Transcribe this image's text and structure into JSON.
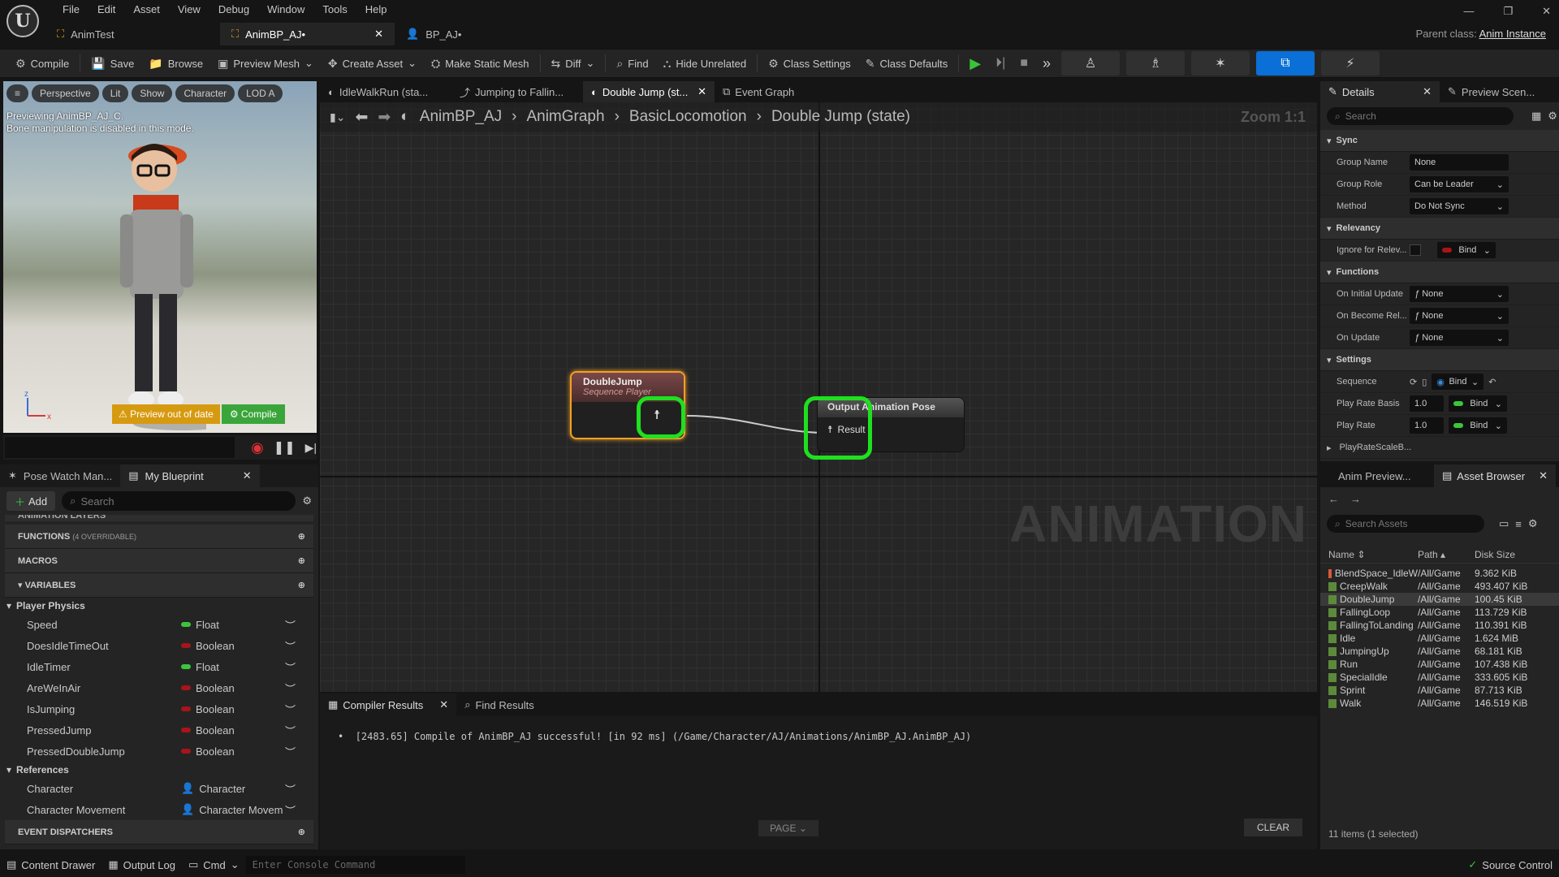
{
  "menu": [
    "File",
    "Edit",
    "Asset",
    "View",
    "Debug",
    "Window",
    "Tools",
    "Help"
  ],
  "doc_tabs": [
    {
      "label": "AnimTest",
      "active": false
    },
    {
      "label": "AnimBP_AJ•",
      "active": true
    },
    {
      "label": "BP_AJ•",
      "active": false
    }
  ],
  "parent_class": {
    "label": "Parent class:",
    "value": "Anim Instance"
  },
  "toolbar": {
    "compile": "Compile",
    "save": "Save",
    "browse": "Browse",
    "preview_mesh": "Preview Mesh",
    "create_asset": "Create Asset",
    "make_static_mesh": "Make Static Mesh",
    "diff": "Diff",
    "find": "Find",
    "hide_unrelated": "Hide Unrelated",
    "class_settings": "Class Settings",
    "class_defaults": "Class Defaults"
  },
  "viewport": {
    "pills": [
      "Perspective",
      "Lit",
      "Show",
      "Character",
      "LOD A"
    ],
    "note1": "Previewing AnimBP_AJ_C.",
    "note2": "Bone manipulation is disabled in this mode.",
    "preview_out_of_date": "Preview out of date",
    "compile": "Compile",
    "axis_z": "z",
    "axis_x": "x"
  },
  "left_panel": {
    "tabs": [
      "Pose Watch Man...",
      "My Blueprint"
    ],
    "add": "Add",
    "search_placeholder": "Search",
    "clipped_section": "ANIMATION LAYERS",
    "functions": "FUNCTIONS",
    "functions_note": "(4 OVERRIDABLE)",
    "macros": "MACROS",
    "variables": "VARIABLES",
    "player_physics": "Player Physics",
    "vars": [
      {
        "name": "Speed",
        "type": "Float",
        "color": "#3cc43c"
      },
      {
        "name": "DoesIdleTimeOut",
        "type": "Boolean",
        "color": "#a8141a"
      },
      {
        "name": "IdleTimer",
        "type": "Float",
        "color": "#3cc43c"
      },
      {
        "name": "AreWeInAir",
        "type": "Boolean",
        "color": "#a8141a"
      },
      {
        "name": "IsJumping",
        "type": "Boolean",
        "color": "#a8141a"
      },
      {
        "name": "PressedJump",
        "type": "Boolean",
        "color": "#a8141a"
      },
      {
        "name": "PressedDoubleJump",
        "type": "Boolean",
        "color": "#a8141a"
      }
    ],
    "references": "References",
    "refs": [
      {
        "name": "Character",
        "type": "Character"
      },
      {
        "name": "Character Movement",
        "type": "Character Movem"
      }
    ],
    "event_dispatchers": "EVENT DISPATCHERS"
  },
  "graph": {
    "tabs": [
      "IdleWalkRun (sta...",
      "Jumping to Fallin...",
      "Double Jump (st...",
      "Event Graph"
    ],
    "breadcrumb": [
      "AnimBP_AJ",
      "AnimGraph",
      "BasicLocomotion",
      "Double Jump (state)"
    ],
    "zoom": "Zoom 1:1",
    "watermark": "ANIMATION",
    "node1_title": "DoubleJump",
    "node1_sub": "Sequence Player",
    "node2_title": "Output Animation Pose",
    "node2_pin": "Result"
  },
  "bottom": {
    "tabs": [
      "Compiler Results",
      "Find Results"
    ],
    "log": "[2483.65] Compile of AnimBP_AJ successful! [in 92 ms] (/Game/Character/AJ/Animations/AnimBP_AJ.AnimBP_AJ)",
    "page": "PAGE",
    "clear": "CLEAR"
  },
  "details": {
    "tabs": [
      "Details",
      "Preview Scen..."
    ],
    "search_placeholder": "Search",
    "sync": "Sync",
    "group_name": "Group Name",
    "group_name_val": "None",
    "group_role": "Group Role",
    "group_role_val": "Can be Leader",
    "method": "Method",
    "method_val": "Do Not Sync",
    "relevancy": "Relevancy",
    "ignore": "Ignore for Relev...",
    "bind": "Bind",
    "functions": "Functions",
    "on_initial": "On Initial Update",
    "on_become": "On Become Rel...",
    "on_update": "On Update",
    "none": "None",
    "settings": "Settings",
    "sequence": "Sequence",
    "play_rate_basis": "Play Rate Basis",
    "play_rate": "Play Rate",
    "one": "1.0",
    "play_rate_scale": "PlayRateScaleB..."
  },
  "assets": {
    "tabs": [
      "Anim Preview...",
      "Asset Browser"
    ],
    "search_placeholder": "Search Assets",
    "headers": [
      "Name",
      "Path",
      "Disk Size"
    ],
    "rows": [
      {
        "name": "BlendSpace_IdleW",
        "path": "/All/Game",
        "size": "9.362 KiB",
        "sel": false
      },
      {
        "name": "CreepWalk",
        "path": "/All/Game",
        "size": "493.407 KiB",
        "sel": false
      },
      {
        "name": "DoubleJump",
        "path": "/All/Game",
        "size": "100.45 KiB",
        "sel": true
      },
      {
        "name": "FallingLoop",
        "path": "/All/Game",
        "size": "113.729 KiB",
        "sel": false
      },
      {
        "name": "FallingToLanding",
        "path": "/All/Game",
        "size": "110.391 KiB",
        "sel": false
      },
      {
        "name": "Idle",
        "path": "/All/Game",
        "size": "1.624 MiB",
        "sel": false
      },
      {
        "name": "JumpingUp",
        "path": "/All/Game",
        "size": "68.181 KiB",
        "sel": false
      },
      {
        "name": "Run",
        "path": "/All/Game",
        "size": "107.438 KiB",
        "sel": false
      },
      {
        "name": "SpecialIdle",
        "path": "/All/Game",
        "size": "333.605 KiB",
        "sel": false
      },
      {
        "name": "Sprint",
        "path": "/All/Game",
        "size": "87.713 KiB",
        "sel": false
      },
      {
        "name": "Walk",
        "path": "/All/Game",
        "size": "146.519 KiB",
        "sel": false
      }
    ],
    "footer": "11 items (1 selected)"
  },
  "status": {
    "content_drawer": "Content Drawer",
    "output_log": "Output Log",
    "cmd": "Cmd",
    "console_placeholder": "Enter Console Command",
    "source_control": "Source Control"
  }
}
